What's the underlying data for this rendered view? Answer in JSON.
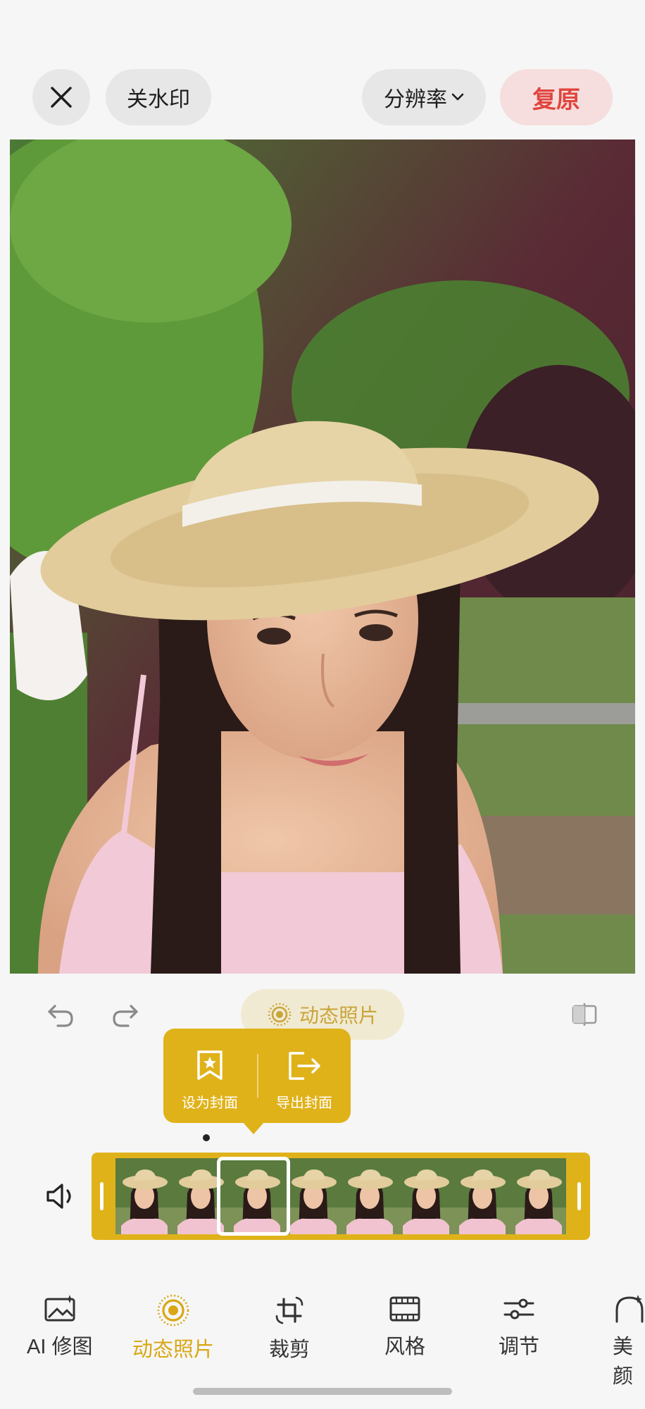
{
  "topbar": {
    "watermark_label": "关水印",
    "resolution_label": "分辨率",
    "restore_label": "复原"
  },
  "live_photo": {
    "pill_label": "动态照片",
    "set_cover_label": "设为封面",
    "export_cover_label": "导出封面"
  },
  "bottom_nav": {
    "items": [
      {
        "label": "AI 修图",
        "icon": "ai-retouch-icon"
      },
      {
        "label": "动态照片",
        "icon": "live-photo-icon"
      },
      {
        "label": "裁剪",
        "icon": "crop-rotate-icon"
      },
      {
        "label": "风格",
        "icon": "film-style-icon"
      },
      {
        "label": "调节",
        "icon": "adjust-sliders-icon"
      },
      {
        "label": "美颜",
        "icon": "beauty-icon"
      }
    ],
    "active_index": 1
  },
  "colors": {
    "accent": "#e0b21a",
    "restore_text": "#e0453f",
    "restore_bg": "#f6dede"
  }
}
